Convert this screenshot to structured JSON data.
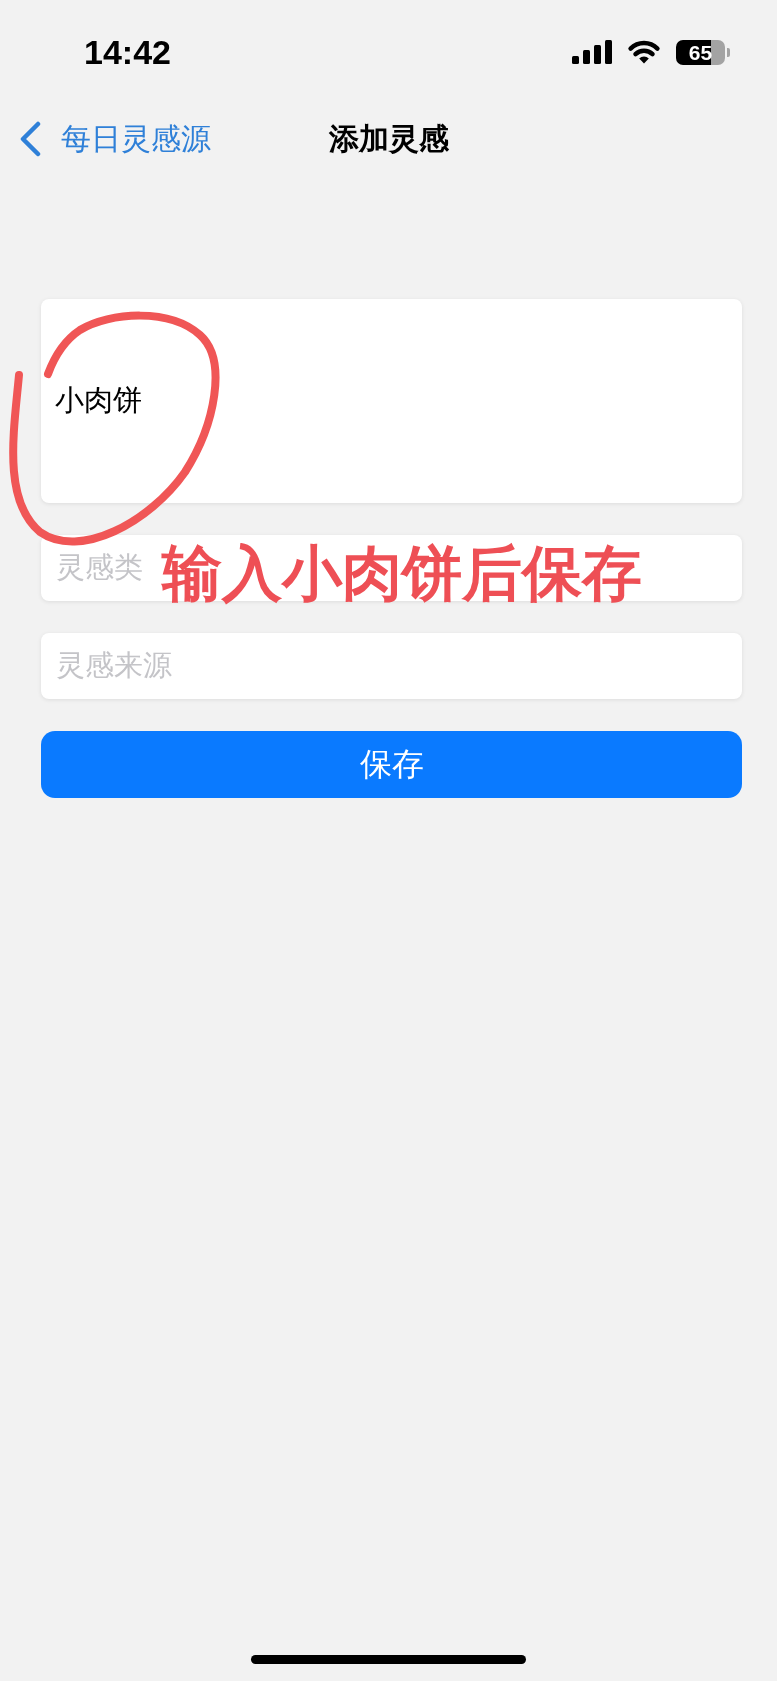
{
  "status_bar": {
    "time": "14:42",
    "battery": "65"
  },
  "nav_bar": {
    "back_label": "每日灵感源",
    "title": "添加灵感"
  },
  "form": {
    "fields": [
      {
        "kind": "textarea",
        "value": "小肉饼"
      },
      {
        "kind": "input",
        "placeholder": "灵感类"
      },
      {
        "kind": "input",
        "placeholder": "灵感来源"
      }
    ],
    "save_button": "保存"
  },
  "annotation": {
    "text": "输入小肉饼后保存"
  }
}
